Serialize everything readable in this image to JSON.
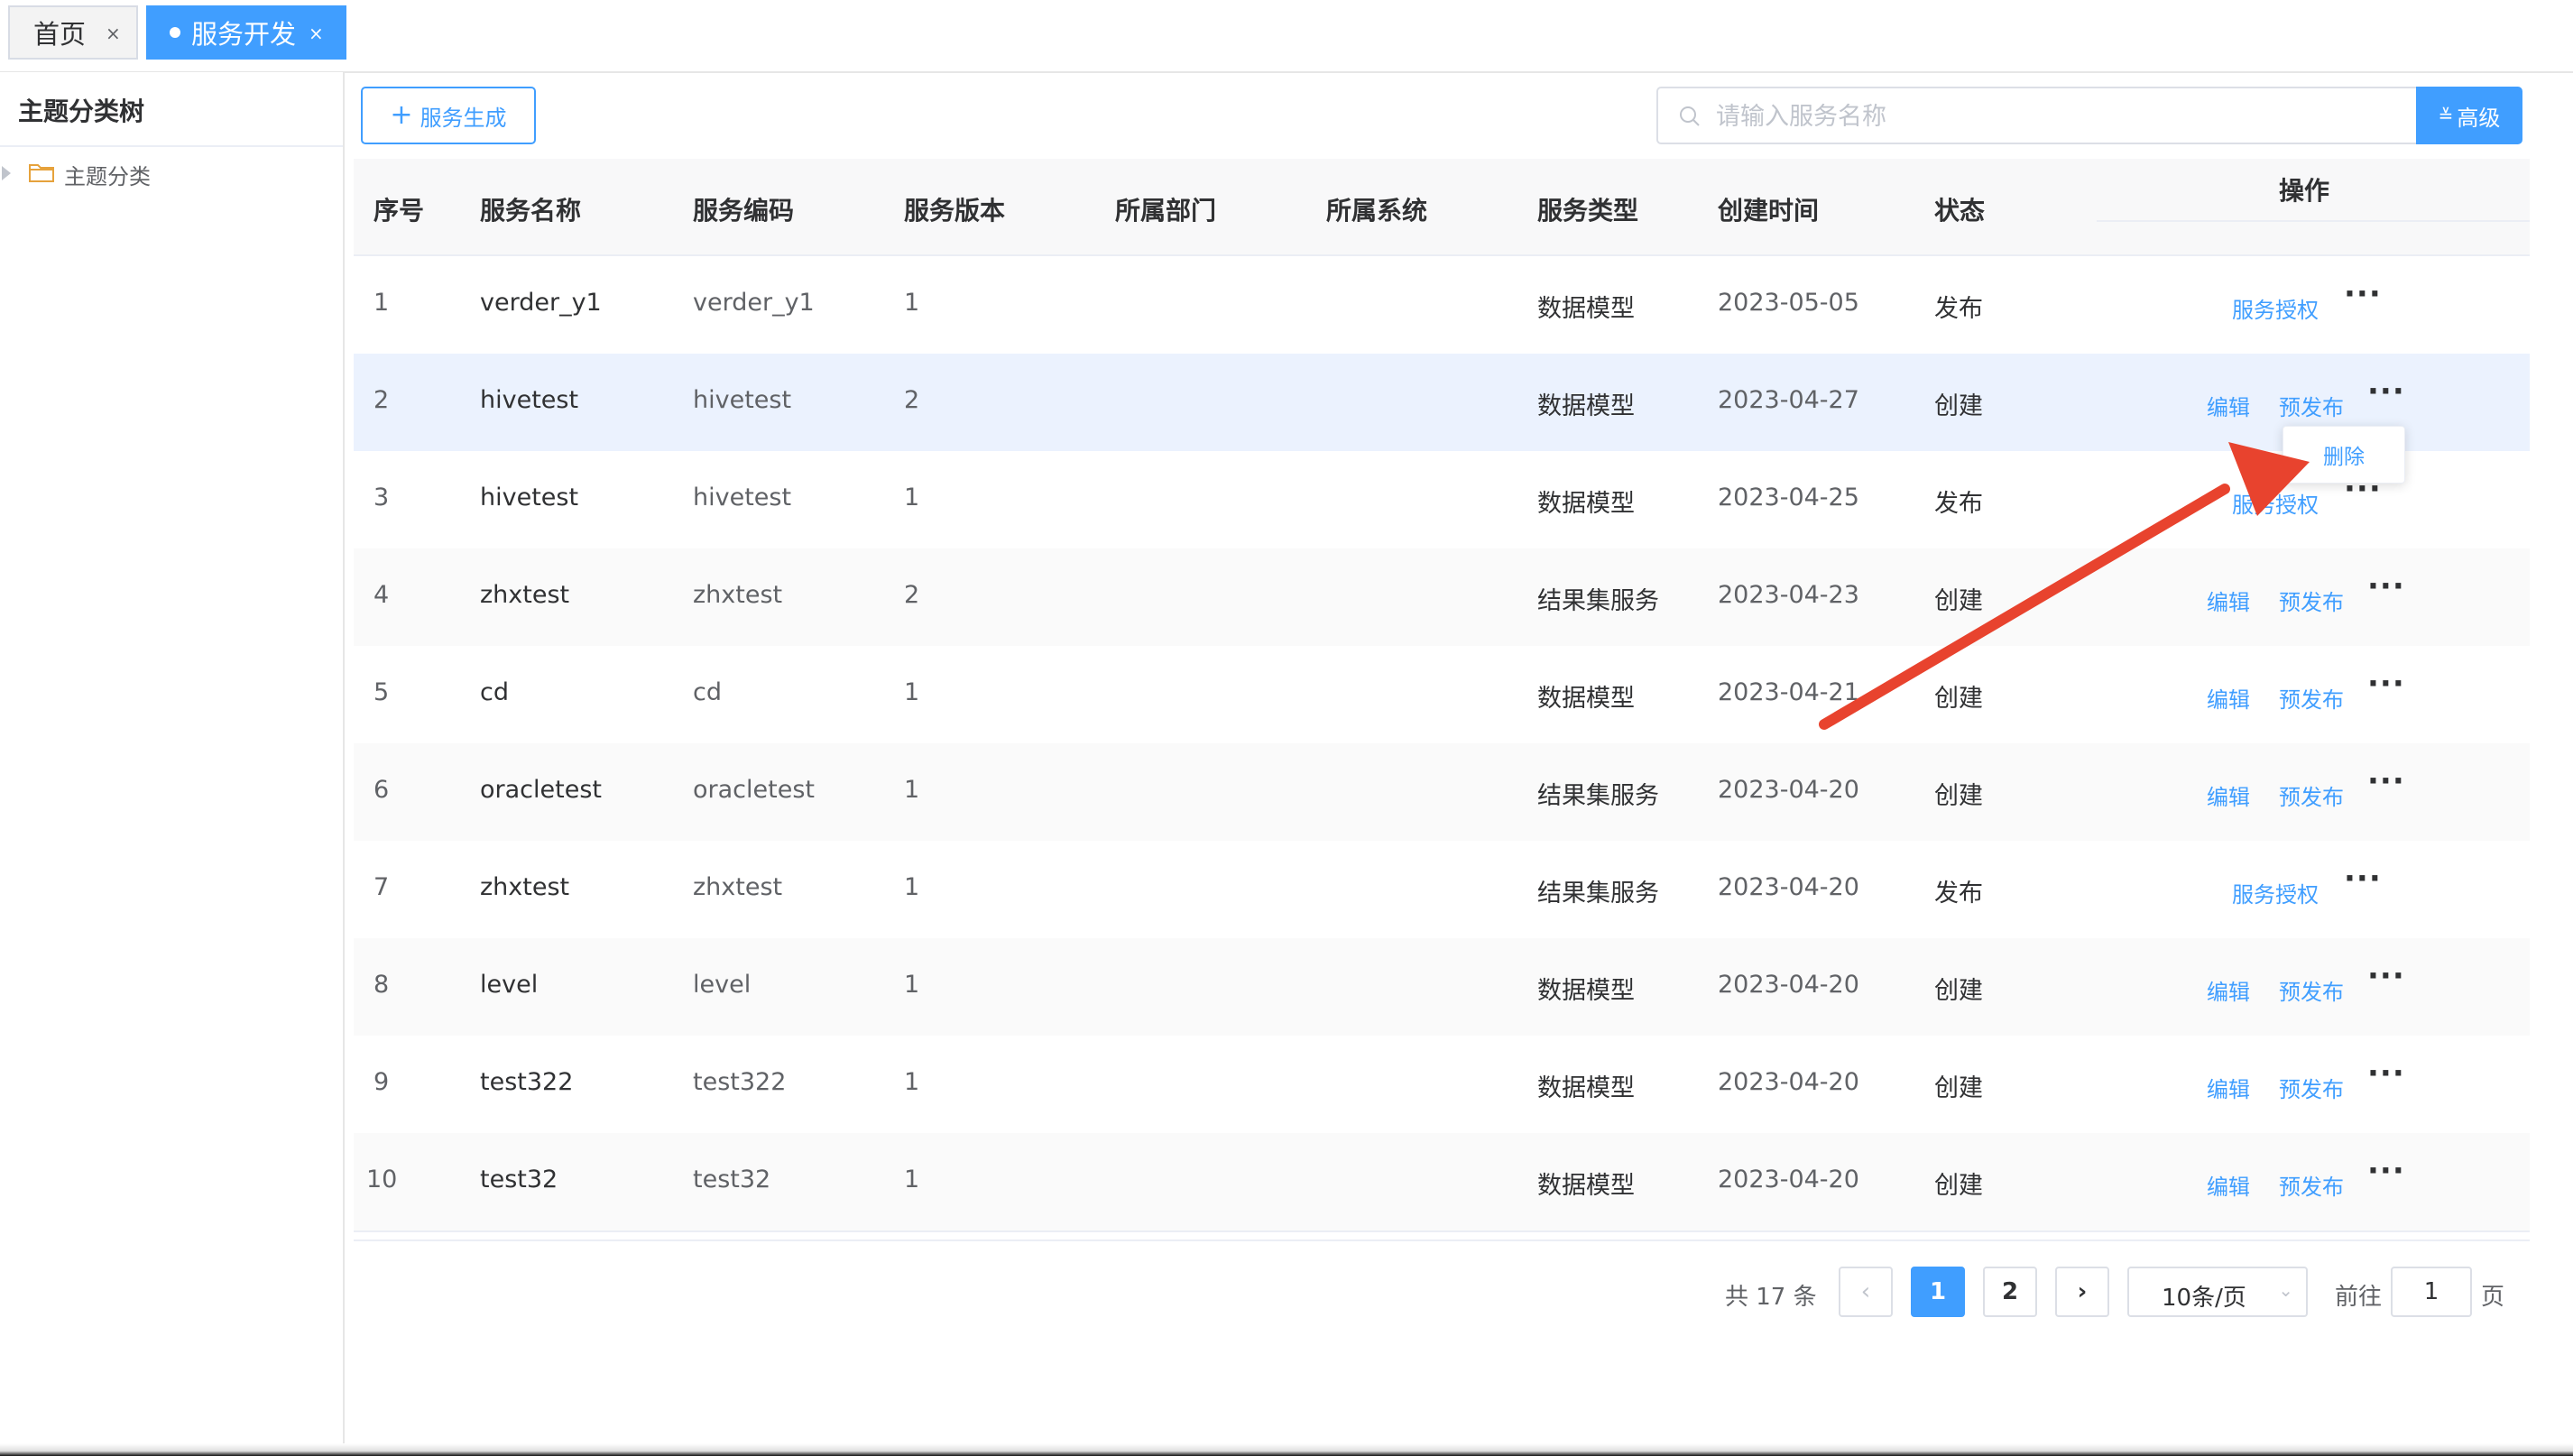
{
  "tabs": [
    {
      "label": "首页",
      "close": "×"
    },
    {
      "label": "服务开发",
      "close": "×"
    }
  ],
  "sidebar": {
    "title": "主题分类树",
    "tree_root": "主题分类"
  },
  "toolbar": {
    "generate_label": "服务生成",
    "search_placeholder": "请输入服务名称",
    "advanced_label": "高级"
  },
  "table": {
    "columns": [
      "序号",
      "服务名称",
      "服务编码",
      "服务版本",
      "所属部门",
      "所属系统",
      "服务类型",
      "创建时间",
      "状态",
      "操作"
    ],
    "rows": [
      {
        "idx": "1",
        "name": "verder_y1",
        "code": "verder_y1",
        "version": "1",
        "dept": "",
        "system": "",
        "type": "数据模型",
        "created": "2023-05-05",
        "status": "发布",
        "actions": [
          "服务授权"
        ]
      },
      {
        "idx": "2",
        "name": "hivetest",
        "code": "hivetest",
        "version": "2",
        "dept": "",
        "system": "",
        "type": "数据模型",
        "created": "2023-04-27",
        "status": "创建",
        "actions": [
          "编辑",
          "预发布"
        ]
      },
      {
        "idx": "3",
        "name": "hivetest",
        "code": "hivetest",
        "version": "1",
        "dept": "",
        "system": "",
        "type": "数据模型",
        "created": "2023-04-25",
        "status": "发布",
        "actions": [
          "服务授权"
        ]
      },
      {
        "idx": "4",
        "name": "zhxtest",
        "code": "zhxtest",
        "version": "2",
        "dept": "",
        "system": "",
        "type": "结果集服务",
        "created": "2023-04-23",
        "status": "创建",
        "actions": [
          "编辑",
          "预发布"
        ]
      },
      {
        "idx": "5",
        "name": "cd",
        "code": "cd",
        "version": "1",
        "dept": "",
        "system": "",
        "type": "数据模型",
        "created": "2023-04-21",
        "status": "创建",
        "actions": [
          "编辑",
          "预发布"
        ]
      },
      {
        "idx": "6",
        "name": "oracletest",
        "code": "oracletest",
        "version": "1",
        "dept": "",
        "system": "",
        "type": "结果集服务",
        "created": "2023-04-20",
        "status": "创建",
        "actions": [
          "编辑",
          "预发布"
        ]
      },
      {
        "idx": "7",
        "name": "zhxtest",
        "code": "zhxtest",
        "version": "1",
        "dept": "",
        "system": "",
        "type": "结果集服务",
        "created": "2023-04-20",
        "status": "发布",
        "actions": [
          "服务授权"
        ]
      },
      {
        "idx": "8",
        "name": "level",
        "code": "level",
        "version": "1",
        "dept": "",
        "system": "",
        "type": "数据模型",
        "created": "2023-04-20",
        "status": "创建",
        "actions": [
          "编辑",
          "预发布"
        ]
      },
      {
        "idx": "9",
        "name": "test322",
        "code": "test322",
        "version": "1",
        "dept": "",
        "system": "",
        "type": "数据模型",
        "created": "2023-04-20",
        "status": "创建",
        "actions": [
          "编辑",
          "预发布"
        ]
      },
      {
        "idx": "10",
        "name": "test32",
        "code": "test32",
        "version": "1",
        "dept": "",
        "system": "",
        "type": "数据模型",
        "created": "2023-04-20",
        "status": "创建",
        "actions": [
          "编辑",
          "预发布"
        ]
      }
    ],
    "more_label": "···"
  },
  "dropdown": {
    "delete_label": "删除"
  },
  "pagination": {
    "total_text": "共 17 条",
    "prev": "‹",
    "pages": [
      "1",
      "2"
    ],
    "current_page": "1",
    "next": "›",
    "page_size": "10条/页",
    "goto_label": "前往",
    "goto_value": "1",
    "page_suffix": "页"
  },
  "colors": {
    "primary": "#409eff",
    "annotation_arrow": "#e8432e",
    "row_hover": "#ebf2fe"
  }
}
